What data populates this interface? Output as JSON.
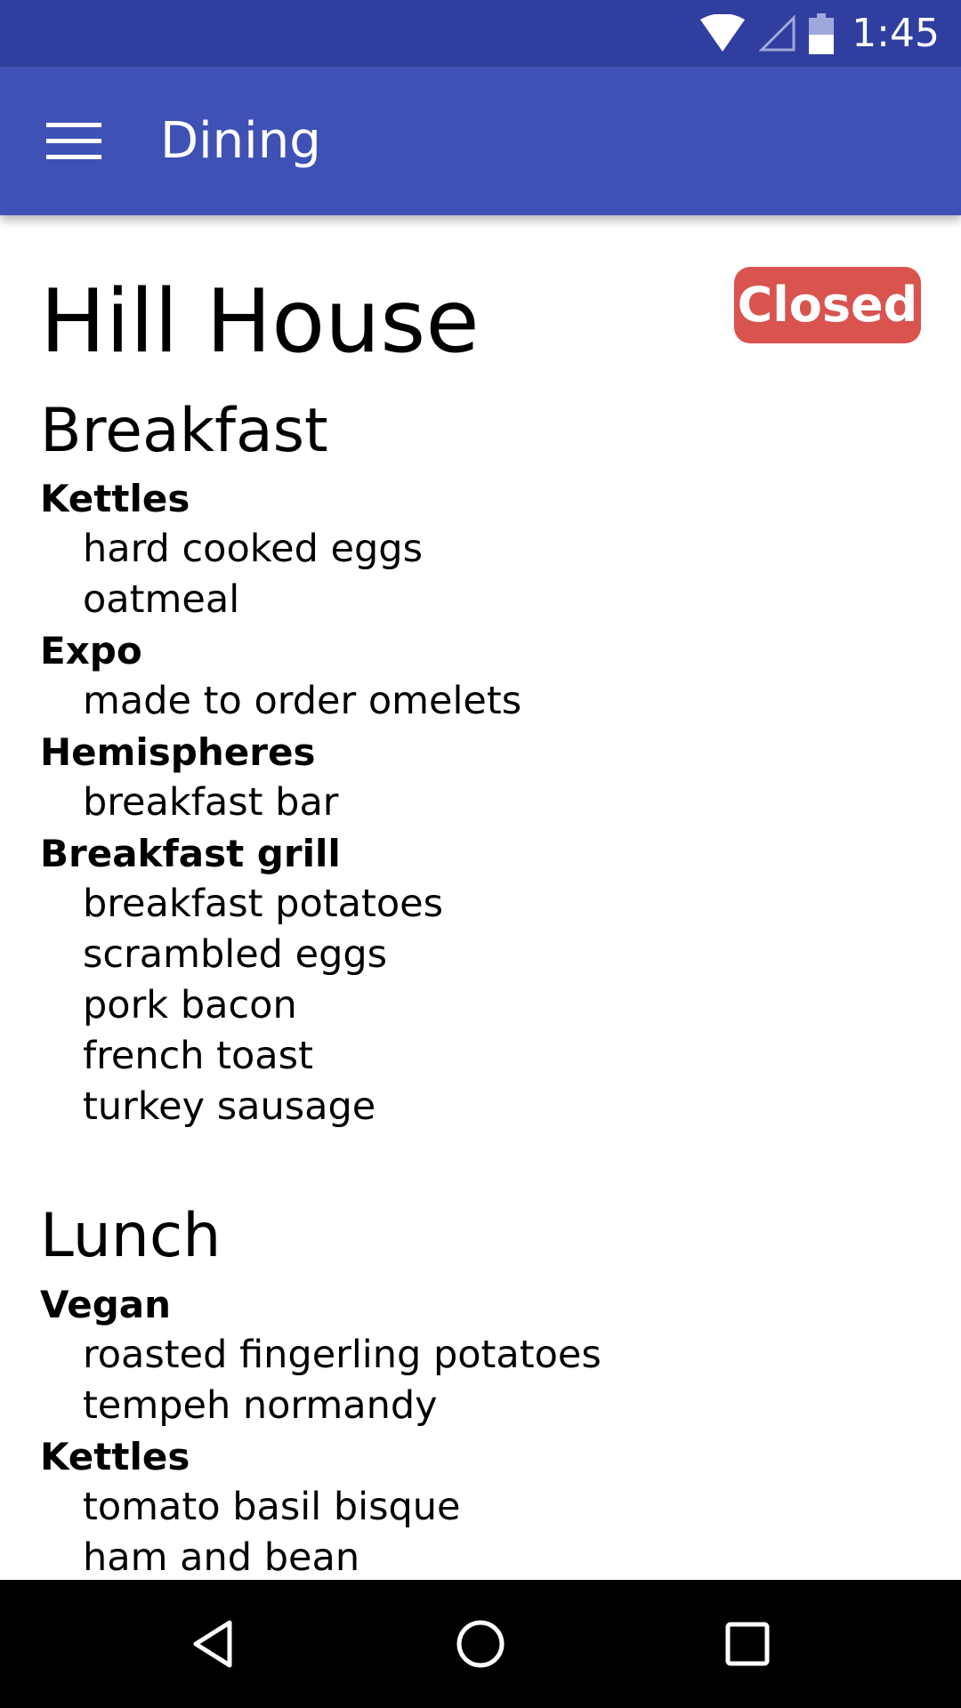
{
  "status_bar": {
    "time": "1:45",
    "icons": [
      "wifi-icon",
      "cell-signal-icon",
      "battery-icon"
    ]
  },
  "app_bar": {
    "menu_icon": "hamburger-menu-icon",
    "title": "Dining"
  },
  "location": {
    "name": "Hill House",
    "status": "Closed",
    "status_color": "#d9534f"
  },
  "meals": {
    "breakfast": {
      "title": "Breakfast",
      "stations": {
        "kettles": {
          "name": "Kettles",
          "items": [
            "hard cooked eggs",
            "oatmeal"
          ]
        },
        "expo": {
          "name": "Expo",
          "items": [
            "made to order omelets"
          ]
        },
        "hemispheres": {
          "name": "Hemispheres",
          "items": [
            "breakfast bar"
          ]
        },
        "grill": {
          "name": "Breakfast grill",
          "items": [
            "breakfast potatoes",
            "scrambled eggs",
            "pork bacon",
            "french toast",
            "turkey sausage"
          ]
        }
      }
    },
    "lunch": {
      "title": "Lunch",
      "stations": {
        "vegan": {
          "name": "Vegan",
          "items": [
            "roasted fingerling potatoes",
            "tempeh normandy"
          ]
        },
        "kettles": {
          "name": "Kettles",
          "items": [
            "tomato basil bisque",
            "ham and bean"
          ]
        }
      }
    }
  },
  "nav_bar": {
    "icons": [
      "back-icon",
      "home-icon",
      "recents-icon"
    ]
  },
  "colors": {
    "status_bar": "#303f9f",
    "app_bar": "#3f51b5",
    "nav_bar": "#000000"
  }
}
